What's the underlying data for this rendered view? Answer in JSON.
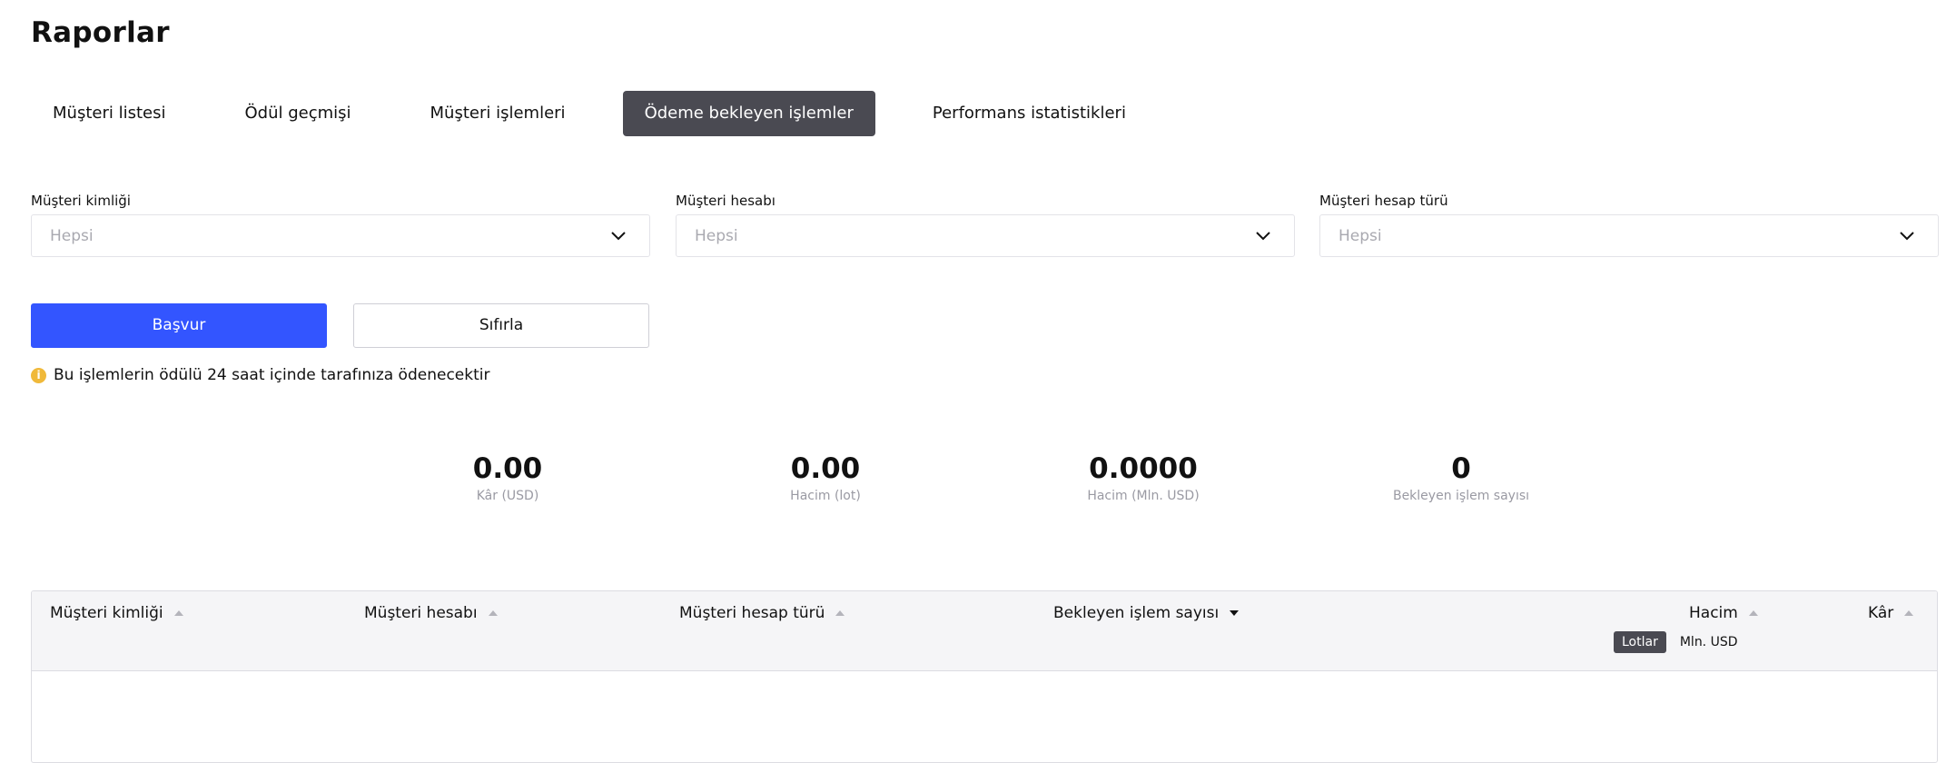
{
  "page": {
    "title": "Raporlar"
  },
  "tabs": [
    {
      "label": "Müşteri listesi"
    },
    {
      "label": "Ödül geçmişi"
    },
    {
      "label": "Müşteri işlemleri"
    },
    {
      "label": "Ödeme bekleyen işlemler",
      "active": true
    },
    {
      "label": "Performans istatistikleri"
    }
  ],
  "filters": [
    {
      "label": "Müşteri kimliği",
      "value": "Hepsi"
    },
    {
      "label": "Müşteri hesabı",
      "value": "Hepsi"
    },
    {
      "label": "Müşteri hesap türü",
      "value": "Hepsi"
    }
  ],
  "buttons": {
    "apply": "Başvur",
    "reset": "Sıfırla"
  },
  "notice": {
    "icon": "info-icon",
    "color": "#f0b93a",
    "text": "Bu işlemlerin ödülü 24 saat içinde tarafınıza ödenecektir"
  },
  "stats": [
    {
      "value": "0.00",
      "label": "Kâr (USD)"
    },
    {
      "value": "0.00",
      "label": "Hacim (lot)"
    },
    {
      "value": "0.0000",
      "label": "Hacim (Mln. USD)"
    },
    {
      "value": "0",
      "label": "Bekleyen işlem sayısı"
    }
  ],
  "table": {
    "columns": [
      {
        "label": "Müşteri kimliği",
        "sort": "up"
      },
      {
        "label": "Müşteri hesabı",
        "sort": "up"
      },
      {
        "label": "Müşteri hesap türü",
        "sort": "up"
      },
      {
        "label": "Bekleyen işlem sayısı",
        "sort": "down"
      },
      {
        "label": "Hacim",
        "sort": "up"
      },
      {
        "label": "Kâr",
        "sort": "up"
      }
    ],
    "unit_toggle": {
      "active": "Lotlar",
      "inactive": "Mln. USD"
    },
    "rows": []
  },
  "colors": {
    "accent": "#3355ff",
    "active_tab": "#4a4a52"
  }
}
